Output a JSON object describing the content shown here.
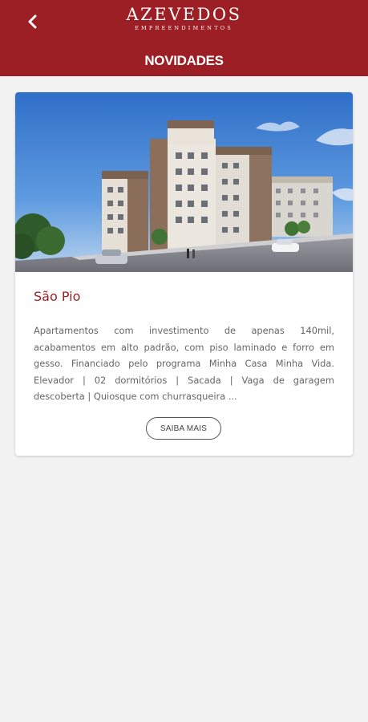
{
  "header": {
    "logo_main": "AZEVEDOS",
    "logo_sub": "EMPREENDIMENTOS",
    "title": "NOVIDADES",
    "back_icon": "chevron-left-icon"
  },
  "colors": {
    "brand": "#9b1f24",
    "background": "#f2f2f2",
    "text": "#666666"
  },
  "listing": {
    "title": "São Pio",
    "description": "Apartamentos com investimento de apenas 140mil, acabamentos em alto padrão, com piso laminado e forro em gesso. Financiado pelo programa Minha Casa Minha Vida. Elevador | 02 dormitórios | Sacada | Vaga de garagem descoberta | Quiosque com churrasqueira ...",
    "button_label": "SAIBA MAIS",
    "image": "apartment-building-render"
  }
}
